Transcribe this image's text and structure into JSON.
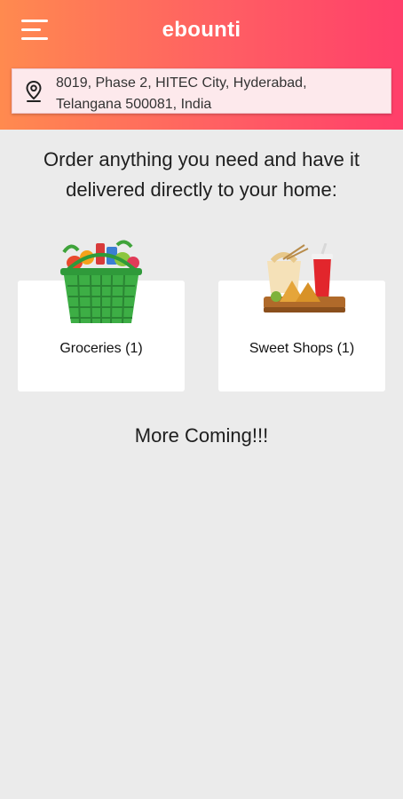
{
  "header": {
    "title": "ebounti",
    "menu_icon": "hamburger-menu-icon",
    "gradient_colors": [
      "#ff8a4f",
      "#ff3f6a"
    ]
  },
  "address": {
    "icon": "location-pin-icon",
    "line1": "8019, Phase 2, HITEC City, Hyderabad,",
    "line2": "Telangana 500081, India"
  },
  "main": {
    "headline_line1": "Order anything you need and have it",
    "headline_line2": "delivered directly to your home:",
    "categories": [
      {
        "label": "Groceries (1)",
        "icon": "grocery-basket-icon"
      },
      {
        "label": "Sweet Shops (1)",
        "icon": "sweets-snacks-icon"
      }
    ],
    "footer_text": "More Coming!!!"
  }
}
